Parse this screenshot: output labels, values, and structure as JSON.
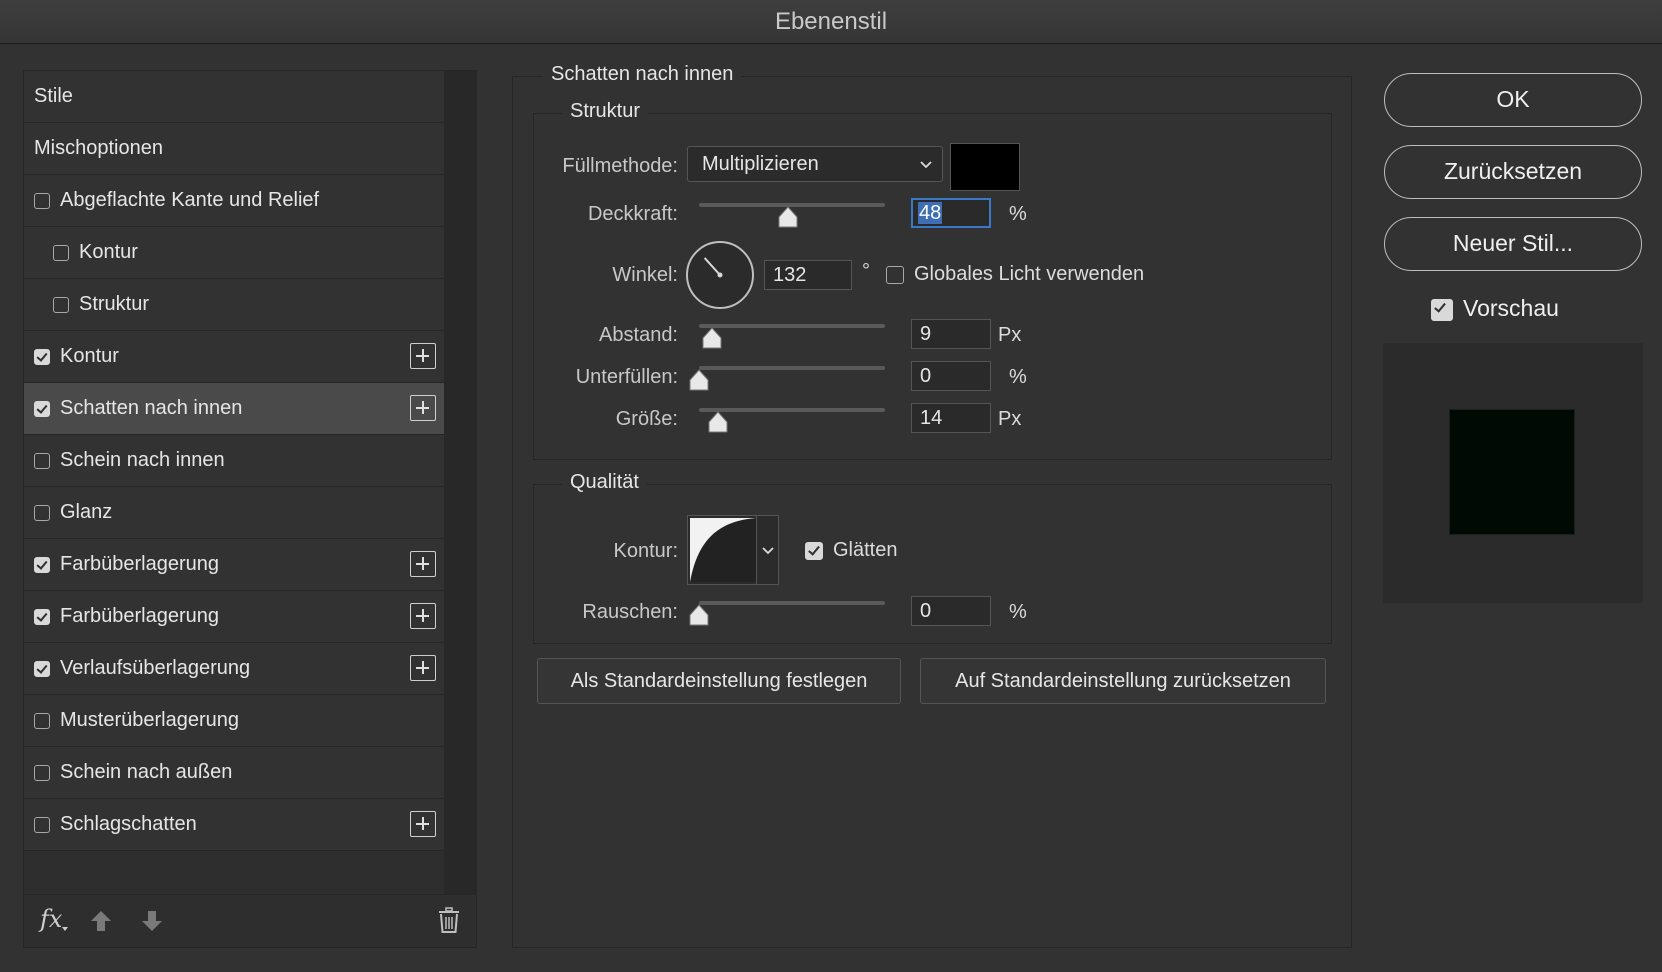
{
  "window": {
    "title": "Ebenenstil"
  },
  "styles": {
    "items": [
      {
        "label": "Stile",
        "checkbox": false,
        "checked": false,
        "indent": 0,
        "plus": false,
        "selected": false
      },
      {
        "label": "Mischoptionen",
        "checkbox": false,
        "checked": false,
        "indent": 0,
        "plus": false,
        "selected": false
      },
      {
        "label": "Abgeflachte Kante und Relief",
        "checkbox": true,
        "checked": false,
        "indent": 0,
        "plus": false,
        "selected": false
      },
      {
        "label": "Kontur",
        "checkbox": true,
        "checked": false,
        "indent": 1,
        "plus": false,
        "selected": false
      },
      {
        "label": "Struktur",
        "checkbox": true,
        "checked": false,
        "indent": 1,
        "plus": false,
        "selected": false
      },
      {
        "label": "Kontur",
        "checkbox": true,
        "checked": true,
        "indent": 0,
        "plus": true,
        "selected": false
      },
      {
        "label": "Schatten nach innen",
        "checkbox": true,
        "checked": true,
        "indent": 0,
        "plus": true,
        "selected": true
      },
      {
        "label": "Schein nach innen",
        "checkbox": true,
        "checked": false,
        "indent": 0,
        "plus": false,
        "selected": false
      },
      {
        "label": "Glanz",
        "checkbox": true,
        "checked": false,
        "indent": 0,
        "plus": false,
        "selected": false
      },
      {
        "label": "Farbüberlagerung",
        "checkbox": true,
        "checked": true,
        "indent": 0,
        "plus": true,
        "selected": false
      },
      {
        "label": "Farbüberlagerung",
        "checkbox": true,
        "checked": true,
        "indent": 0,
        "plus": true,
        "selected": false
      },
      {
        "label": "Verlaufsüberlagerung",
        "checkbox": true,
        "checked": true,
        "indent": 0,
        "plus": true,
        "selected": false
      },
      {
        "label": "Musterüberlagerung",
        "checkbox": true,
        "checked": false,
        "indent": 0,
        "plus": false,
        "selected": false
      },
      {
        "label": "Schein nach außen",
        "checkbox": true,
        "checked": false,
        "indent": 0,
        "plus": false,
        "selected": false
      },
      {
        "label": "Schlagschatten",
        "checkbox": true,
        "checked": false,
        "indent": 0,
        "plus": true,
        "selected": false
      }
    ],
    "footer": {
      "fx": "fx",
      "icons": [
        "fx-icon",
        "arrow-up-icon",
        "arrow-down-icon",
        "trash-icon"
      ]
    }
  },
  "panel": {
    "title": "Schatten nach innen",
    "struktur": {
      "title": "Struktur",
      "blend_label": "Füllmethode:",
      "blend_value": "Multiplizieren",
      "color": "#000000",
      "opacity_label": "Deckkraft:",
      "opacity_value": "48",
      "opacity_fraction": 0.48,
      "opacity_unit": "%",
      "angle_label": "Winkel:",
      "angle_value": "132",
      "angle_deg": 132,
      "angle_unit": "°",
      "global_light_label": "Globales Licht verwenden",
      "global_light_checked": false,
      "distance_label": "Abstand:",
      "distance_value": "9",
      "distance_fraction": 0.07,
      "distance_unit": "Px",
      "choke_label": "Unterfüllen:",
      "choke_value": "0",
      "choke_fraction": 0,
      "choke_unit": "%",
      "size_label": "Größe:",
      "size_value": "14",
      "size_fraction": 0.1,
      "size_unit": "Px"
    },
    "qualitaet": {
      "title": "Qualität",
      "contour_label": "Kontur:",
      "antialias_label": "Glätten",
      "antialias_checked": true,
      "noise_label": "Rauschen:",
      "noise_value": "0",
      "noise_fraction": 0,
      "noise_unit": "%"
    },
    "buttons": {
      "make_default": "Als Standardeinstellung festlegen",
      "reset_default": "Auf Standardeinstellung zurücksetzen"
    }
  },
  "actions": {
    "ok": "OK",
    "reset": "Zurücksetzen",
    "new_style": "Neuer Stil...",
    "preview_label": "Vorschau",
    "preview_checked": true,
    "preview_color": "#000a04"
  }
}
